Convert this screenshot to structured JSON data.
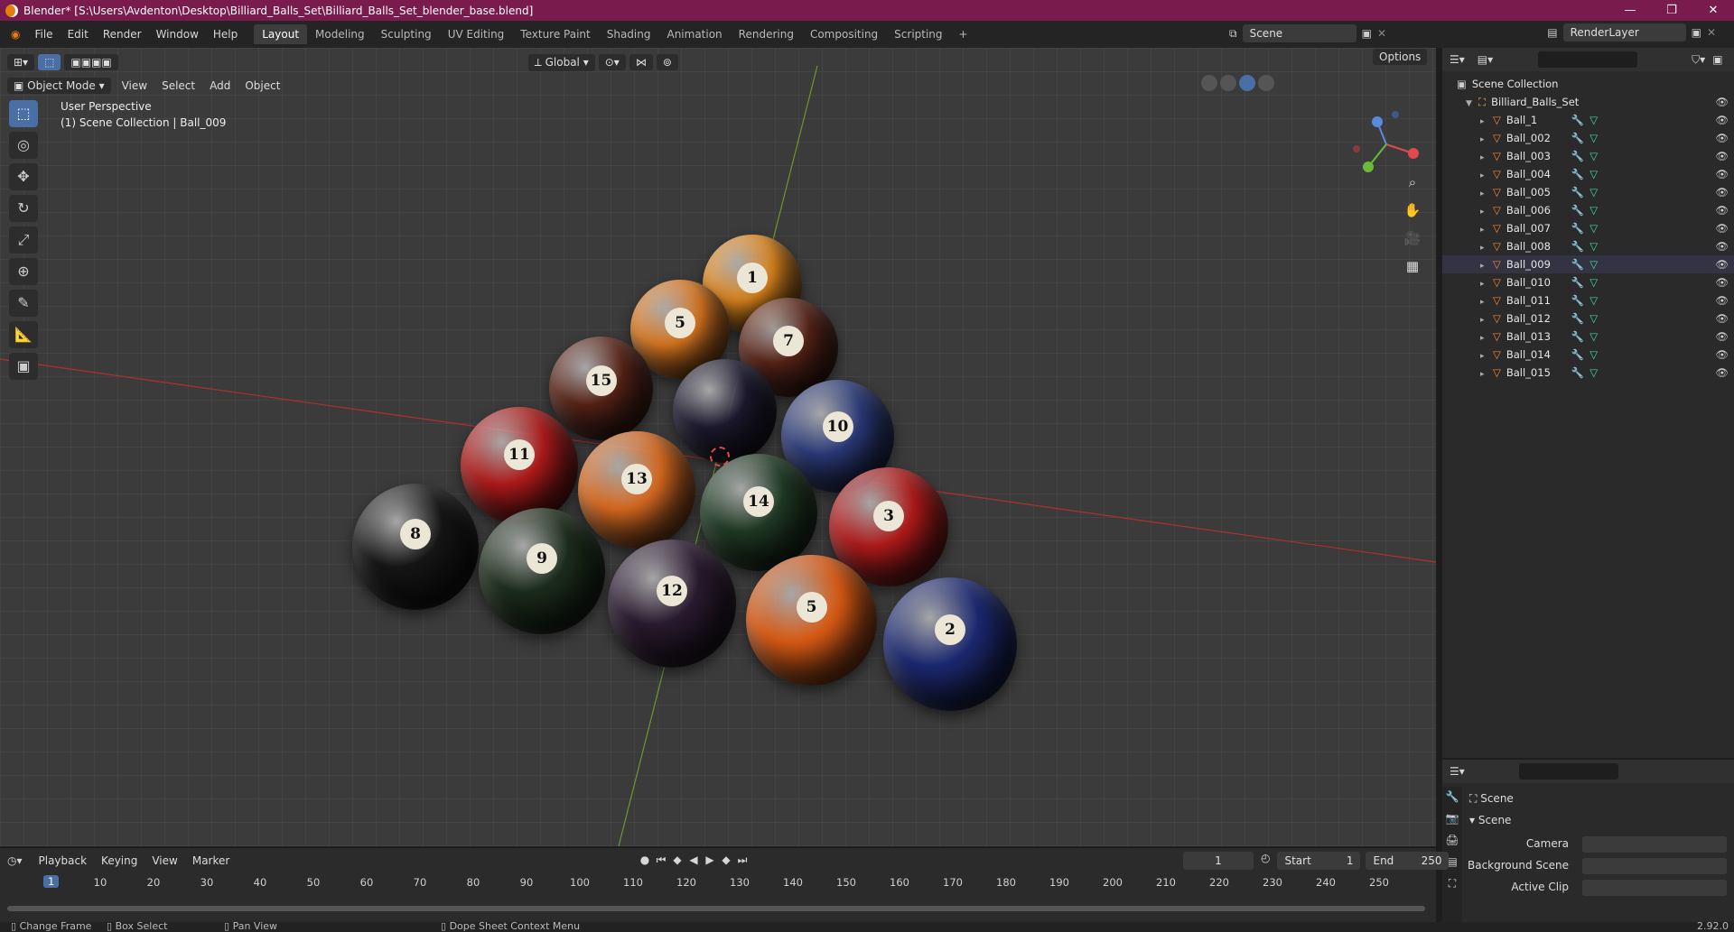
{
  "title_bar": {
    "text": "Blender* [S:\\Users\\Avdenton\\Desktop\\Billiard_Balls_Set\\Billiard_Balls_Set_blender_base.blend]",
    "controls": [
      "—",
      "❐",
      "✕"
    ]
  },
  "menu": [
    "File",
    "Edit",
    "Render",
    "Window",
    "Help"
  ],
  "workspaces": [
    "Layout",
    "Modeling",
    "Sculpting",
    "UV Editing",
    "Texture Paint",
    "Shading",
    "Animation",
    "Rendering",
    "Compositing",
    "Scripting",
    "+"
  ],
  "scene": {
    "name": "Scene",
    "render_layer": "RenderLayer"
  },
  "viewport": {
    "mode": "Object Mode",
    "menus": [
      "View",
      "Select",
      "Add",
      "Object"
    ],
    "orientation": "Global",
    "options_label": "Options",
    "perspective": "User Perspective",
    "collection_info": "(1) Scene Collection | Ball_009"
  },
  "balls": [
    {
      "n": "1",
      "color": "#e58a1f"
    },
    {
      "n": "5",
      "color": "#e07a20"
    },
    {
      "n": "7",
      "color": "#5a2418"
    },
    {
      "n": "15",
      "color": "#5a2418"
    },
    {
      "n": "",
      "color": "#1d1a30"
    },
    {
      "n": "10",
      "color": "#2a3a7a"
    },
    {
      "n": "11",
      "color": "#b01a1a"
    },
    {
      "n": "13",
      "color": "#d86a20"
    },
    {
      "n": "14",
      "color": "#1f3a24"
    },
    {
      "n": "3",
      "color": "#b01a1a"
    },
    {
      "n": "8",
      "color": "#151515"
    },
    {
      "n": "9",
      "color": "#1c2d1c"
    },
    {
      "n": "12",
      "color": "#2a1a30"
    },
    {
      "n": "5",
      "color": "#d85a14"
    },
    {
      "n": "2",
      "color": "#1b2870"
    }
  ],
  "outliner": {
    "root": "Scene Collection",
    "collection": "Billiard_Balls_Set",
    "items": [
      "Ball_1",
      "Ball_002",
      "Ball_003",
      "Ball_004",
      "Ball_005",
      "Ball_006",
      "Ball_007",
      "Ball_008",
      "Ball_009",
      "Ball_010",
      "Ball_011",
      "Ball_012",
      "Ball_013",
      "Ball_014",
      "Ball_015"
    ]
  },
  "properties": {
    "context": "Scene",
    "panel": "Scene",
    "fields": [
      {
        "label": "Camera"
      },
      {
        "label": "Background Scene"
      },
      {
        "label": "Active Clip"
      }
    ]
  },
  "timeline": {
    "menus": [
      "Playback",
      "Keying",
      "View",
      "Marker"
    ],
    "current_frame": "1",
    "start_label": "Start",
    "start": "1",
    "end_label": "End",
    "end": "250",
    "ticks": [
      "10",
      "20",
      "30",
      "40",
      "50",
      "60",
      "70",
      "80",
      "90",
      "100",
      "110",
      "120",
      "130",
      "140",
      "150",
      "160",
      "170",
      "180",
      "190",
      "200",
      "210",
      "220",
      "230",
      "240",
      "250"
    ]
  },
  "status": {
    "items": [
      "Change Frame",
      "Box Select",
      "Pan View",
      "Dope Sheet Context Menu"
    ],
    "version": "2.92.0"
  }
}
